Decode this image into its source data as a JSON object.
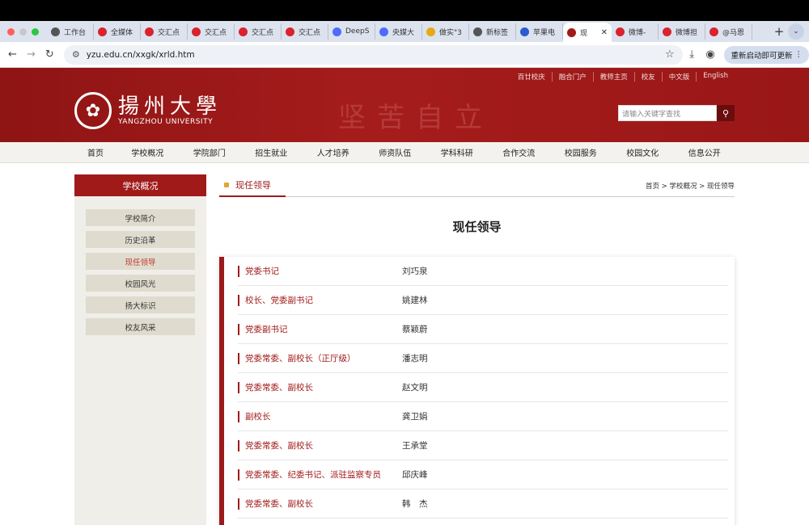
{
  "browser": {
    "tabs": [
      {
        "label": "工作台",
        "icon": "globe-icon",
        "color": "#555"
      },
      {
        "label": "全媒体",
        "icon": "weibo-icon",
        "color": "#d9232f"
      },
      {
        "label": "交汇点",
        "icon": "weibo-icon",
        "color": "#d9232f"
      },
      {
        "label": "交汇点",
        "icon": "weibo-icon",
        "color": "#d9232f"
      },
      {
        "label": "交汇点",
        "icon": "weibo-icon",
        "color": "#d9232f"
      },
      {
        "label": "交汇点",
        "icon": "weibo-icon",
        "color": "#d9232f"
      },
      {
        "label": "DeepS",
        "icon": "deepseek-icon",
        "color": "#4d6bfe"
      },
      {
        "label": "央媒大",
        "icon": "deepseek-icon",
        "color": "#4d6bfe"
      },
      {
        "label": "做实\"3",
        "icon": "doc-icon",
        "color": "#e6a817"
      },
      {
        "label": "新标签",
        "icon": "chrome-icon",
        "color": "#555"
      },
      {
        "label": "苹果电",
        "icon": "paw-icon",
        "color": "#2b5ad0"
      },
      {
        "label": "现",
        "icon": "yzu-icon",
        "color": "#a11a1a"
      },
      {
        "label": "微博-",
        "icon": "weibo-icon",
        "color": "#d9232f"
      },
      {
        "label": "微博担",
        "icon": "weibo-icon",
        "color": "#d9232f"
      },
      {
        "label": "@马恩",
        "icon": "weibo-icon",
        "color": "#d9232f"
      }
    ],
    "url": "yzu.edu.cn/xxgk/xrld.htm",
    "relaunch_label": "重新启动即可更新"
  },
  "site": {
    "top_links": [
      "百廿校庆",
      "融合门户",
      "教师主页",
      "校友",
      "中文版",
      "English"
    ],
    "logo_cn": "揚州大學",
    "logo_en": "YANGZHOU UNIVERSITY",
    "motto": "坚苦自立",
    "search_placeholder": "请输入关键字查找",
    "nav": [
      "首页",
      "学校概况",
      "学院部门",
      "招生就业",
      "人才培养",
      "师资队伍",
      "学科科研",
      "合作交流",
      "校园服务",
      "校园文化",
      "信息公开"
    ],
    "sidebar": {
      "title": "学校概况",
      "items": [
        "学校简介",
        "历史沿革",
        "现任领导",
        "校园风光",
        "扬大标识",
        "校友风采"
      ]
    },
    "section_title": "现任领导",
    "breadcrumb": "首页 > 学校概况 > 现任领导",
    "page_title": "现任领导",
    "leaders": [
      {
        "title": "党委书记",
        "name": "刘巧泉"
      },
      {
        "title": "校长、党委副书记",
        "name": "姚建林"
      },
      {
        "title": "党委副书记",
        "name": "蔡颖蔚"
      },
      {
        "title": "党委常委、副校长（正厅级）",
        "name": "潘志明"
      },
      {
        "title": "党委常委、副校长",
        "name": "赵文明"
      },
      {
        "title": "副校长",
        "name": "龚卫娟"
      },
      {
        "title": "党委常委、副校长",
        "name": "王承堂"
      },
      {
        "title": "党委常委、纪委书记、派驻监察专员",
        "name": "邱庆峰"
      },
      {
        "title": "党委常委、副校长",
        "name": "韩　杰"
      }
    ]
  }
}
